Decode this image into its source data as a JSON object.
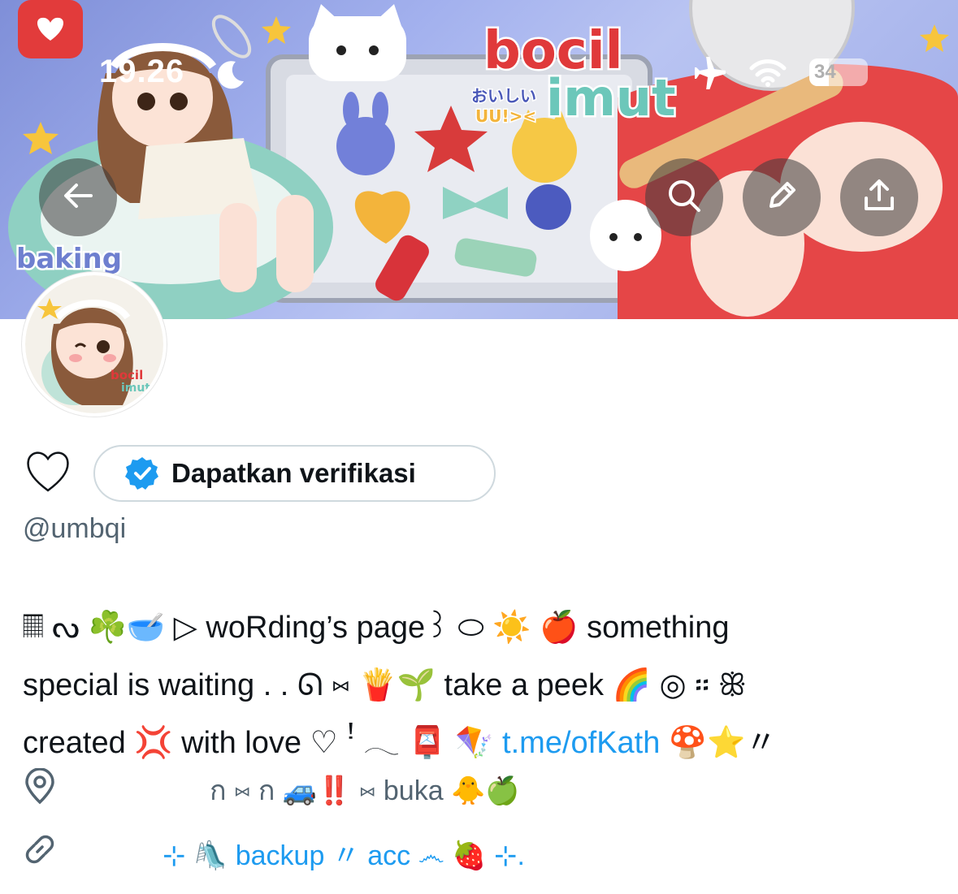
{
  "status_bar": {
    "time": "19.26",
    "battery_level": "34",
    "battery_fraction": 0.34,
    "icons": [
      "moon-icon",
      "airplane-icon",
      "wifi-icon",
      "battery-icon"
    ]
  },
  "banner": {
    "title_line1": "bocil",
    "title_line2": "imut",
    "japanese_text": "おいしい",
    "sub_text": "UU!>< ",
    "side_label": "baking",
    "avatar_text_line1": "bocil",
    "avatar_text_line2": "imut"
  },
  "header_buttons": {
    "back": "back-arrow-icon",
    "search": "search-icon",
    "edit": "pencil-icon",
    "share": "share-icon"
  },
  "profile": {
    "verify_label": "Dapatkan verifikasi",
    "handle": "@umbqi",
    "bio_line1": "𝄜 ᔓ ☘️🥣 ▷ woRding’s page꒱ ⬭ ☀️ 🍎 something",
    "bio_line2": "special is waiting . . ᘏ ⑅ 🍟🌱 take a peek 🌈 ◎ ፡፡ ꕥ",
    "bio_line3_text": "created 💢 with love ♡ ꜝ 𓂃 📮 🪁 ",
    "bio_link": "t.me/ofKath",
    "bio_line3_tail": " 🍄⭐️〃",
    "location": "ก ⑅ ก 🚙‼️ ⑅ buka 🐥🍏",
    "url_text": "⊹ 🛝 backup 〃 acc ෴ 🍓 ⊹."
  },
  "colors": {
    "link": "#1d9bf0",
    "muted": "#536471",
    "text": "#0f1419",
    "verified": "#1d9bf0",
    "button_border": "#cfd9de"
  }
}
